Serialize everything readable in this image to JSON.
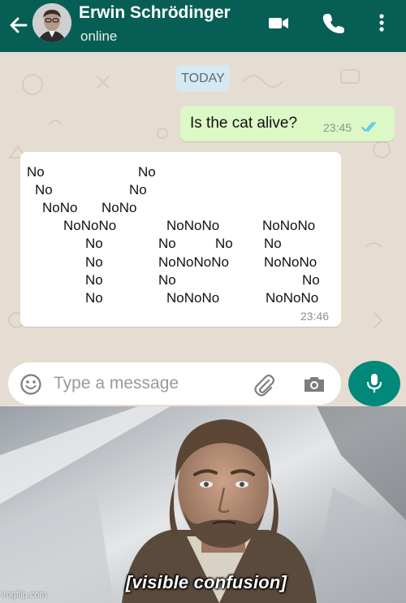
{
  "header": {
    "contact_name": "Erwin Schrödinger",
    "status": "online",
    "back_icon": "arrow-left-icon",
    "video_icon": "video-call-icon",
    "phone_icon": "voice-call-icon",
    "menu_icon": "more-vert-icon",
    "bar_color": "#075e54"
  },
  "chat": {
    "date_chip": "TODAY",
    "outgoing": {
      "text": "Is the cat alive?",
      "time": "23:45",
      "status_icon": "double-check-read-icon",
      "bubble_color": "#dcf8c6"
    },
    "incoming": {
      "lines": [
        [
          "No",
          "No"
        ],
        [
          "No",
          "No"
        ],
        [
          "NoNo",
          "NoNo"
        ],
        [
          "NoNoNo",
          "NoNoNo",
          "NoNoNo"
        ],
        [
          "No",
          "No",
          "No",
          "No"
        ],
        [
          "No",
          "NoNoNoNo",
          "NoNoNo"
        ],
        [
          "No",
          "No",
          "No"
        ],
        [
          "No",
          "NoNoNo",
          "NoNoNo"
        ]
      ],
      "time": "23:46",
      "bubble_color": "#ffffff"
    }
  },
  "composer": {
    "placeholder": "Type a message",
    "emoji_icon": "emoji-icon",
    "attach_icon": "paperclip-icon",
    "camera_icon": "camera-icon",
    "mic_icon": "microphone-icon",
    "accent_color": "#00897b"
  },
  "meme": {
    "caption": "[visible confusion]",
    "watermark": "imgflip.com"
  }
}
